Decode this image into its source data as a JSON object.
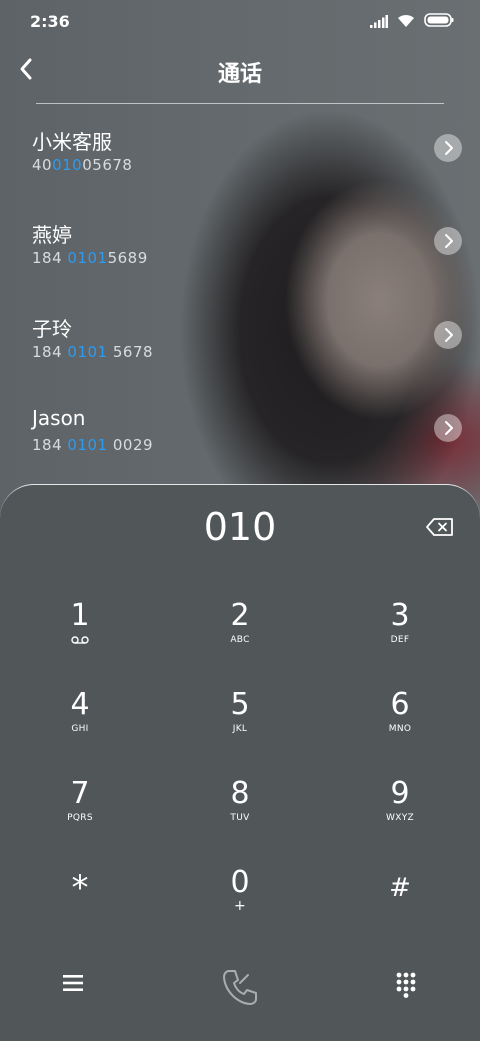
{
  "status": {
    "time": "2:36"
  },
  "header": {
    "title": "通话"
  },
  "contacts": [
    {
      "name": "小米客服",
      "num_pre": "40",
      "num_hl": "010",
      "num_post": "05678"
    },
    {
      "name": "燕婷",
      "num_pre": "184 ",
      "num_hl": "0101",
      "num_post": "5689"
    },
    {
      "name": "子玲",
      "num_pre": "184 ",
      "num_hl": "0101",
      "num_post": " 5678"
    },
    {
      "name": "Jason",
      "num_pre": "184 ",
      "num_hl": "0101",
      "num_post": " 0029"
    }
  ],
  "dialpad": {
    "entry": "010",
    "keys": [
      {
        "digit": "1",
        "sub": ""
      },
      {
        "digit": "2",
        "sub": "ABC"
      },
      {
        "digit": "3",
        "sub": "DEF"
      },
      {
        "digit": "4",
        "sub": "GHI"
      },
      {
        "digit": "5",
        "sub": "JKL"
      },
      {
        "digit": "6",
        "sub": "MNO"
      },
      {
        "digit": "7",
        "sub": "PQRS"
      },
      {
        "digit": "8",
        "sub": "TUV"
      },
      {
        "digit": "9",
        "sub": "WXYZ"
      },
      {
        "digit": "*",
        "sub": ""
      },
      {
        "digit": "0",
        "sub": "+"
      },
      {
        "digit": "#",
        "sub": ""
      }
    ]
  },
  "colors": {
    "highlight": "#2d9bf0",
    "pad_bg": "#515759"
  },
  "icons": {
    "back": "chevron-left-icon",
    "delete": "backspace-icon",
    "menu": "menu-icon",
    "call": "phone-icon",
    "keypad": "dialpad-icon"
  }
}
